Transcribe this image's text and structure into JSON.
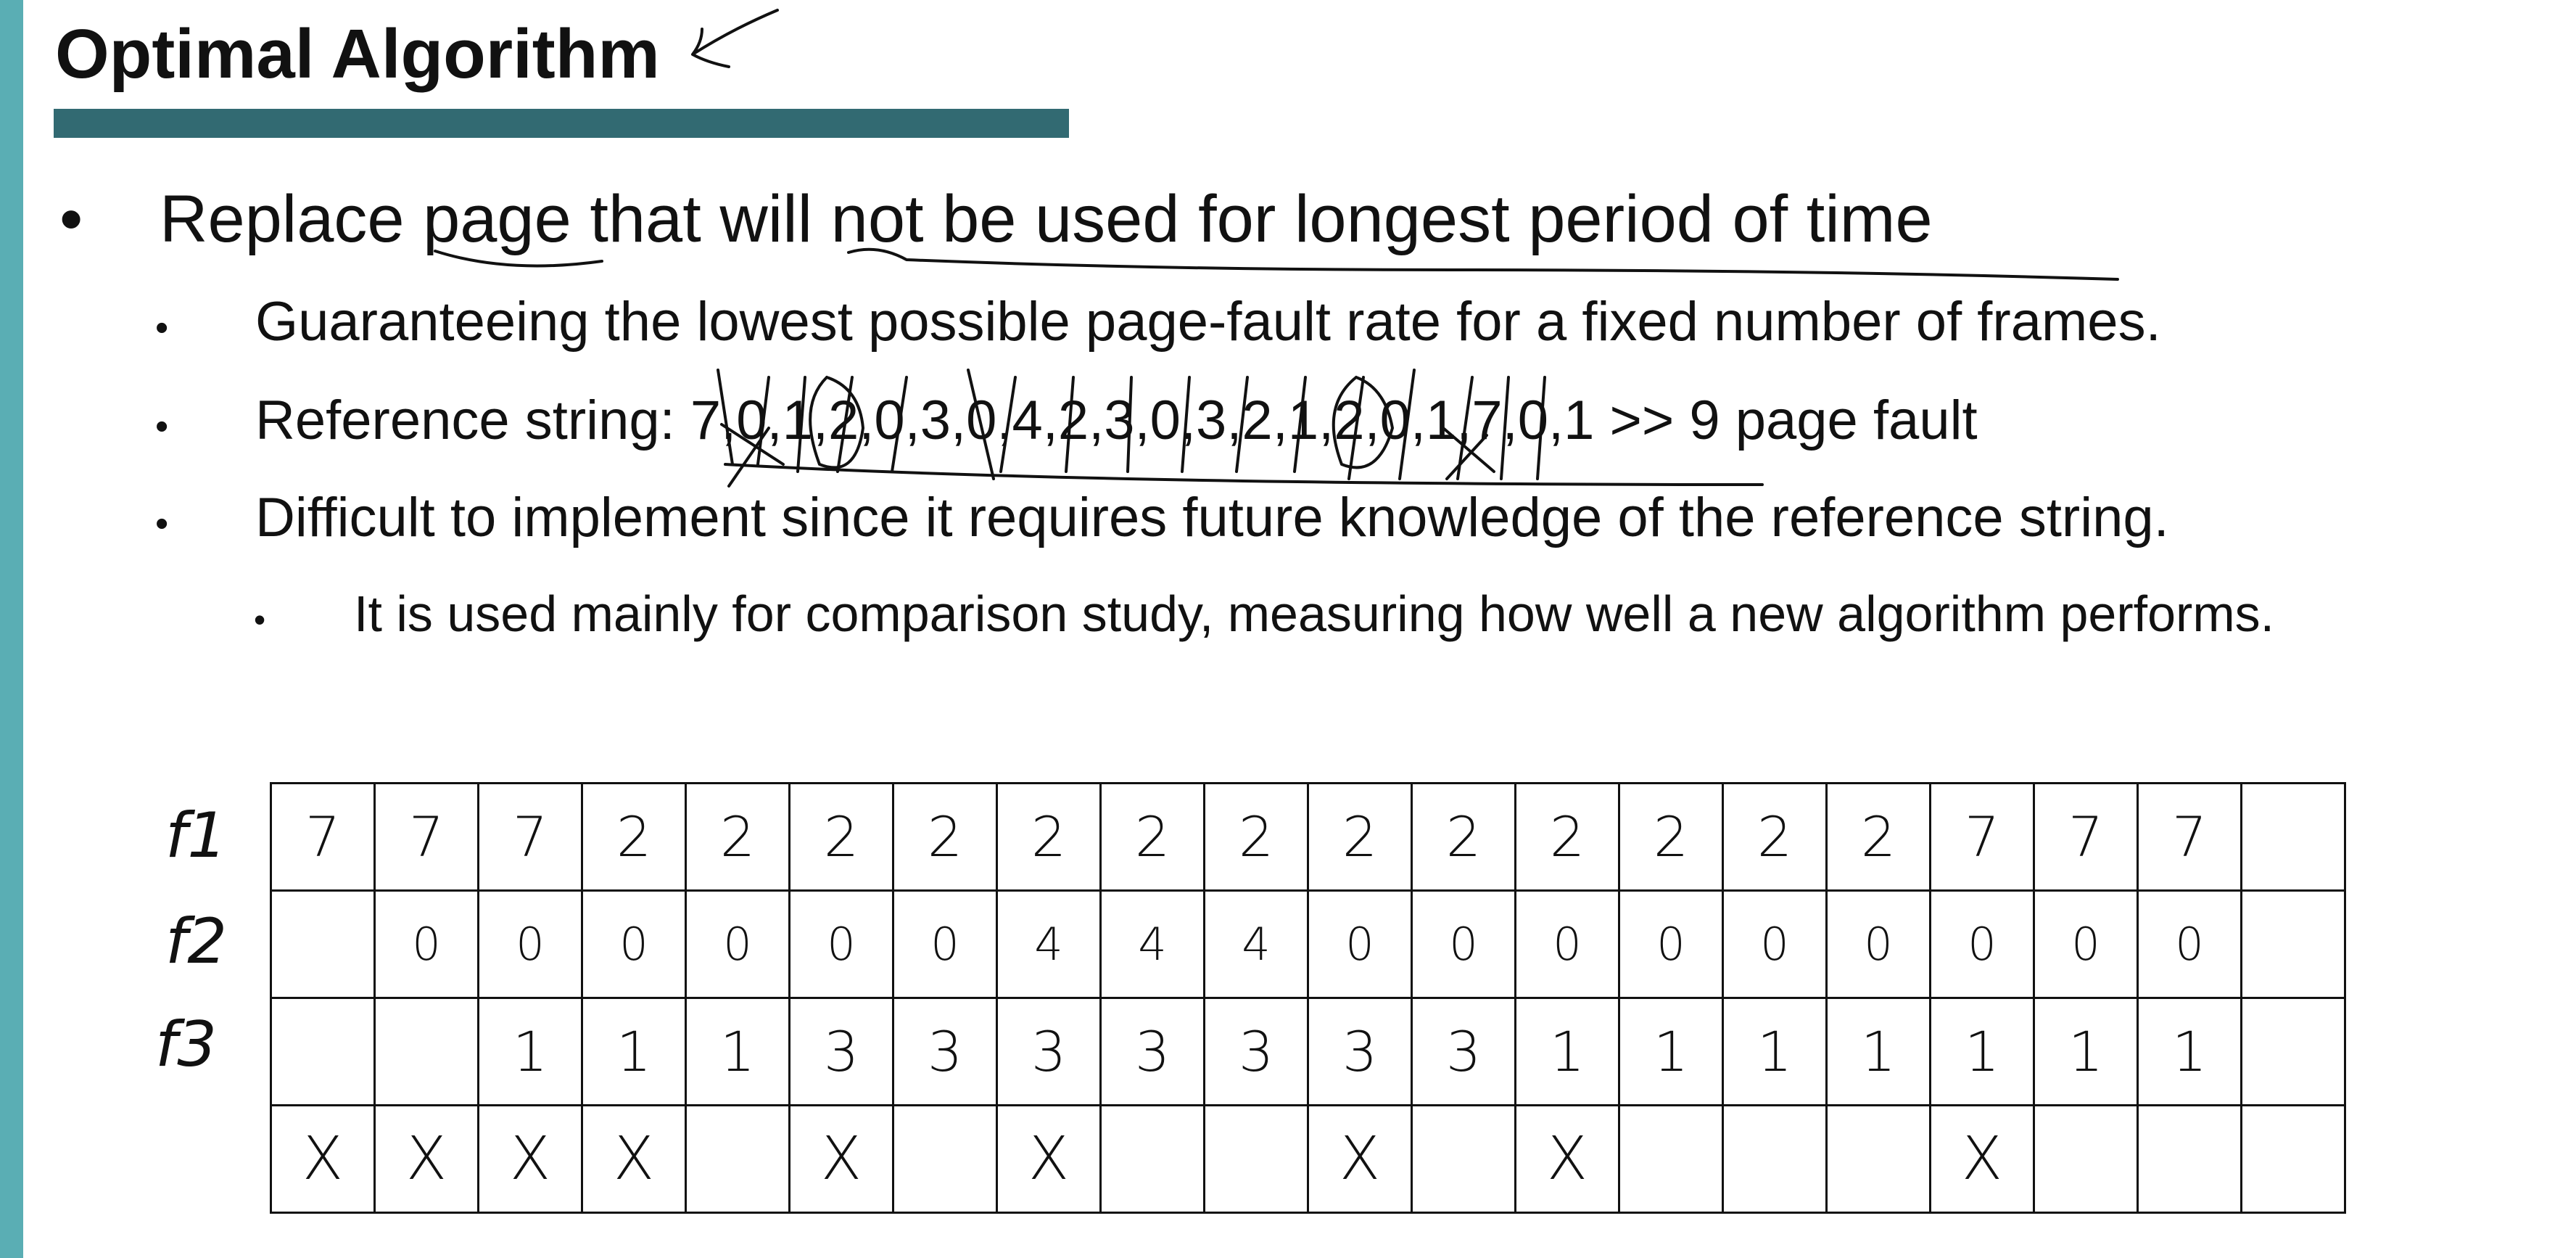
{
  "title": "Optimal Algorithm",
  "bullets": {
    "main": "Replace page that will not be used for longest period of time",
    "guarantee": "Guaranteeing the lowest possible page-fault rate for a fixed number of frames.",
    "reference": "Reference string: 7,0,1,2,0,3,0,4,2,3,0,3,2,1,2,0,1,7,0,1 >> 9 page fault",
    "difficult": "Difficult to implement since it requires future knowledge of the reference string.",
    "comparison": "It is used mainly for comparison study, measuring how well a new algorithm performs."
  },
  "frame_labels": [
    "f1",
    "f2",
    "f3"
  ],
  "table": {
    "f1": [
      "7",
      "7",
      "7",
      "2",
      "2",
      "2",
      "2",
      "2",
      "2",
      "2",
      "2",
      "2",
      "2",
      "2",
      "2",
      "2",
      "7",
      "7",
      "7",
      ""
    ],
    "f2": [
      "",
      "0",
      "0",
      "0",
      "0",
      "0",
      "0",
      "4",
      "4",
      "4",
      "0",
      "0",
      "0",
      "0",
      "0",
      "0",
      "0",
      "0",
      "0",
      ""
    ],
    "f3": [
      "",
      "",
      "1",
      "1",
      "1",
      "3",
      "3",
      "3",
      "3",
      "3",
      "3",
      "3",
      "1",
      "1",
      "1",
      "1",
      "1",
      "1",
      "1",
      ""
    ],
    "faults": [
      "X",
      "X",
      "X",
      "X",
      "",
      "X",
      "",
      "X",
      "",
      "",
      "X",
      "",
      "X",
      "",
      "",
      "",
      "X",
      "",
      "",
      ""
    ]
  },
  "colors": {
    "accent_stripe": "#5aaeb4",
    "title_bar": "#326a72",
    "ink": "#111111"
  }
}
